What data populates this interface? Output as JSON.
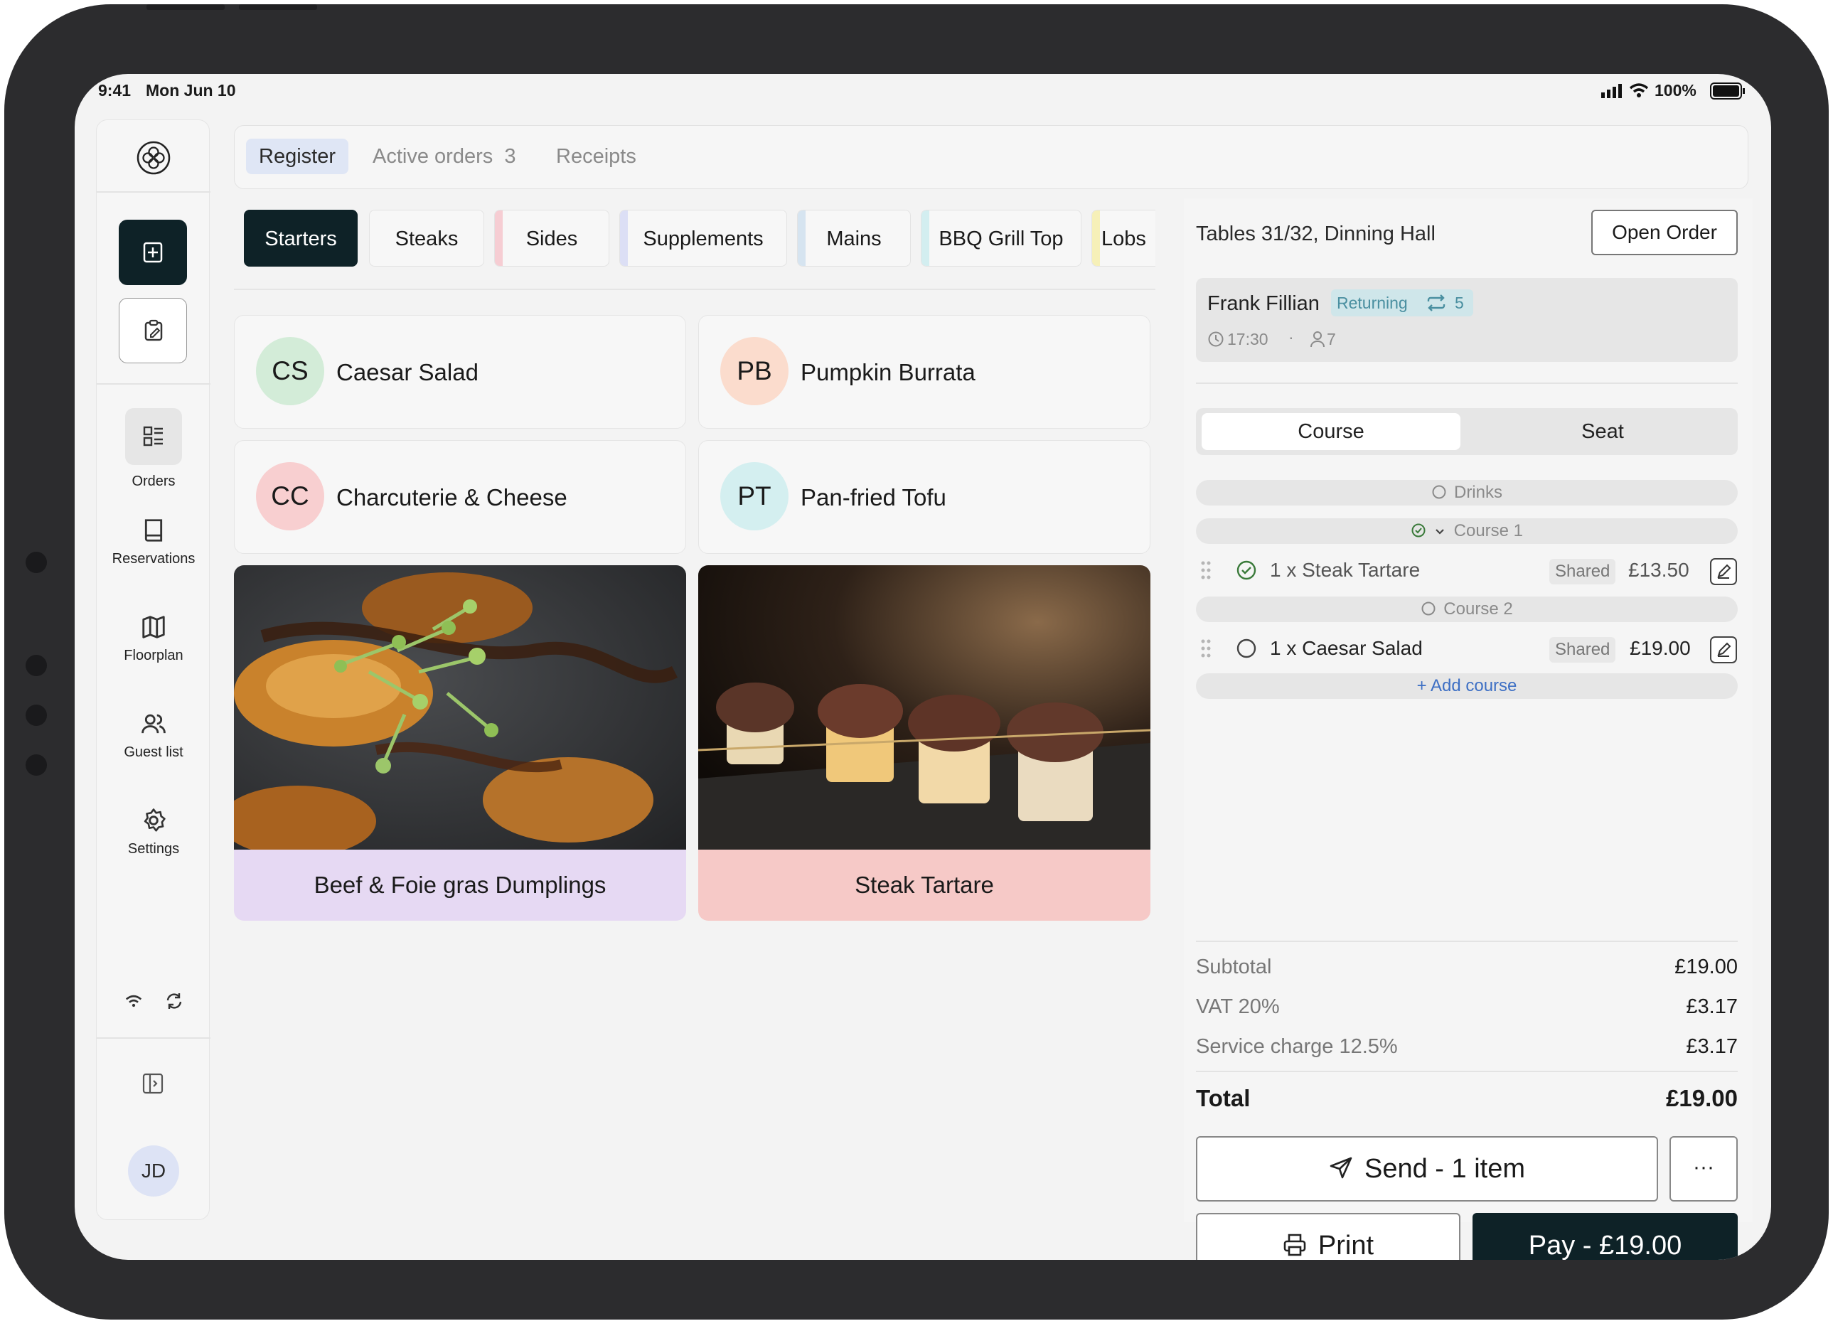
{
  "status_bar": {
    "time": "9:41",
    "date": "Mon Jun 10",
    "battery": "100%"
  },
  "nav": {
    "tabs": [
      {
        "label": "Register"
      },
      {
        "label": "Active orders"
      },
      {
        "label": "Receipts"
      }
    ],
    "active_orders_count": "3"
  },
  "sidebar": {
    "items": [
      {
        "label": "Orders"
      },
      {
        "label": "Reservations"
      },
      {
        "label": "Floorplan"
      },
      {
        "label": "Guest list"
      },
      {
        "label": "Settings"
      }
    ],
    "avatar": "JD"
  },
  "categories": [
    {
      "label": "Starters",
      "color": "#0e2227"
    },
    {
      "label": "Steaks",
      "color": "#e3e3e3"
    },
    {
      "label": "Sides",
      "color": "#f6cdd3"
    },
    {
      "label": "Supplements",
      "color": "#dcdff5"
    },
    {
      "label": "Mains",
      "color": "#d6e4f0"
    },
    {
      "label": "BBQ Grill Top",
      "color": "#d3eef0"
    },
    {
      "label": "Lobs",
      "color": "#f6f0b8"
    }
  ],
  "menu_items": [
    {
      "initials": "CS",
      "name": "Caesar Salad",
      "color": "#d3ecd8"
    },
    {
      "initials": "PB",
      "name": "Pumpkin Burrata",
      "color": "#fbdccd"
    },
    {
      "initials": "CC",
      "name": "Charcuterie & Cheese",
      "color": "#f8cfd0"
    },
    {
      "initials": "PT",
      "name": "Pan-fried Tofu",
      "color": "#d4eff0"
    }
  ],
  "photo_items": [
    {
      "name": "Beef & Foie gras Dumplings",
      "color": "#e6d9f3"
    },
    {
      "name": "Steak Tartare",
      "color": "#f6c9c7"
    }
  ],
  "order": {
    "table": "Tables 31/32, Dinning Hall",
    "open_order_label": "Open Order",
    "guest_name": "Frank Fillian",
    "guest_tag": "Returning",
    "visit_count": "5",
    "time": "17:30",
    "covers": "7",
    "toggle": {
      "course": "Course",
      "seat": "Seat"
    },
    "drinks_label": "Drinks",
    "courses": [
      {
        "label": "Course 1",
        "items": [
          {
            "label": "1 x Steak Tartare",
            "tag": "Shared",
            "price": "£13.50"
          }
        ]
      },
      {
        "label": "Course 2",
        "items": [
          {
            "label": "1 x Caesar Salad",
            "tag": "Shared",
            "price": "£19.00"
          }
        ]
      }
    ],
    "add_course": "+ Add course",
    "summary": {
      "subtotal_label": "Subtotal",
      "subtotal": "£19.00",
      "vat_label": "VAT 20%",
      "vat": "£3.17",
      "service_label": "Service charge 12.5%",
      "service": "£3.17",
      "total_label": "Total",
      "total": "£19.00"
    },
    "send_label": "Send - 1 item",
    "more_label": "···",
    "print_label": "Print",
    "pay_label": "Pay - £19.00"
  }
}
